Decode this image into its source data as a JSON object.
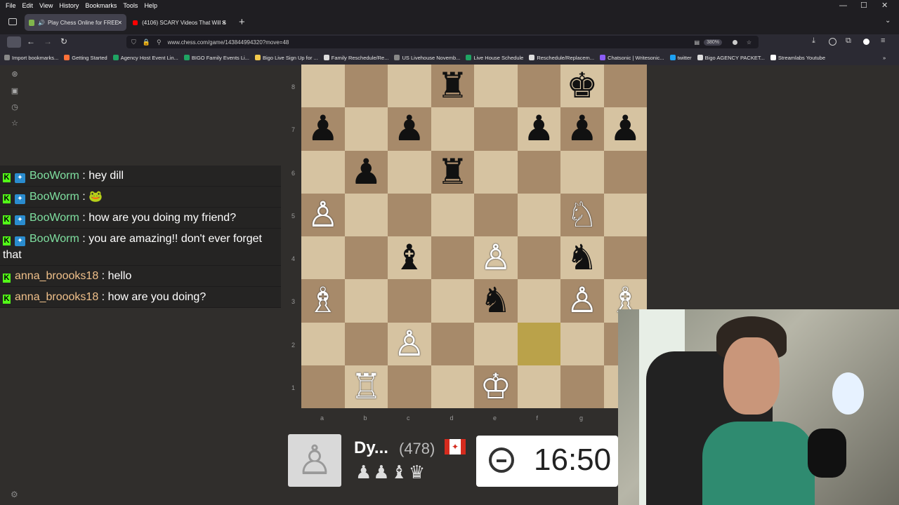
{
  "menu": {
    "items": [
      "File",
      "Edit",
      "View",
      "History",
      "Bookmarks",
      "Tools",
      "Help"
    ]
  },
  "tabs": [
    {
      "title": "Play Chess Online for FREE",
      "active": true
    },
    {
      "title": "(4106) SCARY Videos That Will S",
      "active": false
    }
  ],
  "address": {
    "url": "www.chess.com/game/143844994320?move=48",
    "zoom": "380%"
  },
  "bookmarks": [
    {
      "label": "Import bookmarks...",
      "color": "#888888"
    },
    {
      "label": "Getting Started",
      "color": "#ff7139"
    },
    {
      "label": "Agency Host Event Lin...",
      "color": "#1fa463"
    },
    {
      "label": "BIGO Family Events Li...",
      "color": "#1fa463"
    },
    {
      "label": "Bigo Live Sign Up for ...",
      "color": "#f2c94c"
    },
    {
      "label": "Family Reschedule/Re...",
      "color": "#dddddd"
    },
    {
      "label": "US Livehouse Novemb...",
      "color": "#888888"
    },
    {
      "label": "Live House Schedule",
      "color": "#1fa463"
    },
    {
      "label": "Reschedule/Replacem...",
      "color": "#dddddd"
    },
    {
      "label": "Chatsonic | Writesonic...",
      "color": "#8b5cf6"
    },
    {
      "label": "twitter",
      "color": "#1da1f2"
    },
    {
      "label": "Bigo AGENCY PACKET...",
      "color": "#dddddd"
    },
    {
      "label": "Streamlabs Youtube",
      "color": "#ffffff"
    }
  ],
  "chat": [
    {
      "user": "BooWorm",
      "message": "hey dill",
      "color": "green",
      "badge": true
    },
    {
      "user": "BooWorm",
      "message": "🐸",
      "color": "green",
      "badge": true
    },
    {
      "user": "BooWorm",
      "message": "how are you doing my friend?",
      "color": "green",
      "badge": true
    },
    {
      "user": "BooWorm",
      "message": "you are amazing!! don't ever forget that",
      "color": "green",
      "badge": true
    },
    {
      "user": "anna_broooks18",
      "message": "hello",
      "color": "orange",
      "badge": false
    },
    {
      "user": "anna_broooks18",
      "message": "how are you doing?",
      "color": "orange",
      "badge": false
    }
  ],
  "board": {
    "ranks": [
      "8",
      "7",
      "6",
      "5",
      "4",
      "3",
      "2",
      "1"
    ],
    "files": [
      "a",
      "b",
      "c",
      "d",
      "e",
      "f",
      "g"
    ],
    "highlight": [
      "f2"
    ],
    "pieces": [
      {
        "sq": "d8",
        "p": "♜",
        "c": "black"
      },
      {
        "sq": "g8",
        "p": "♚",
        "c": "black"
      },
      {
        "sq": "a7",
        "p": "♟",
        "c": "black"
      },
      {
        "sq": "c7",
        "p": "♟",
        "c": "black"
      },
      {
        "sq": "f7",
        "p": "♟",
        "c": "black"
      },
      {
        "sq": "g7",
        "p": "♟",
        "c": "black"
      },
      {
        "sq": "h7",
        "p": "♟",
        "c": "black"
      },
      {
        "sq": "b6",
        "p": "♟",
        "c": "black"
      },
      {
        "sq": "d6",
        "p": "♜",
        "c": "black"
      },
      {
        "sq": "a5",
        "p": "♙",
        "c": "white"
      },
      {
        "sq": "g5",
        "p": "♘",
        "c": "white"
      },
      {
        "sq": "c4",
        "p": "♝",
        "c": "black"
      },
      {
        "sq": "e4",
        "p": "♙",
        "c": "white"
      },
      {
        "sq": "g4",
        "p": "♞",
        "c": "black"
      },
      {
        "sq": "a3",
        "p": "♗",
        "c": "white"
      },
      {
        "sq": "e3",
        "p": "♞",
        "c": "black"
      },
      {
        "sq": "g3",
        "p": "♙",
        "c": "white"
      },
      {
        "sq": "h3",
        "p": "♗",
        "c": "white"
      },
      {
        "sq": "c2",
        "p": "♙",
        "c": "white"
      },
      {
        "sq": "b1",
        "p": "♖",
        "c": "white"
      },
      {
        "sq": "e1",
        "p": "♔",
        "c": "white"
      }
    ]
  },
  "player": {
    "name": "Dy...",
    "rating": "(478)",
    "captured": "♟♟♝♛",
    "clock": "16:50"
  }
}
